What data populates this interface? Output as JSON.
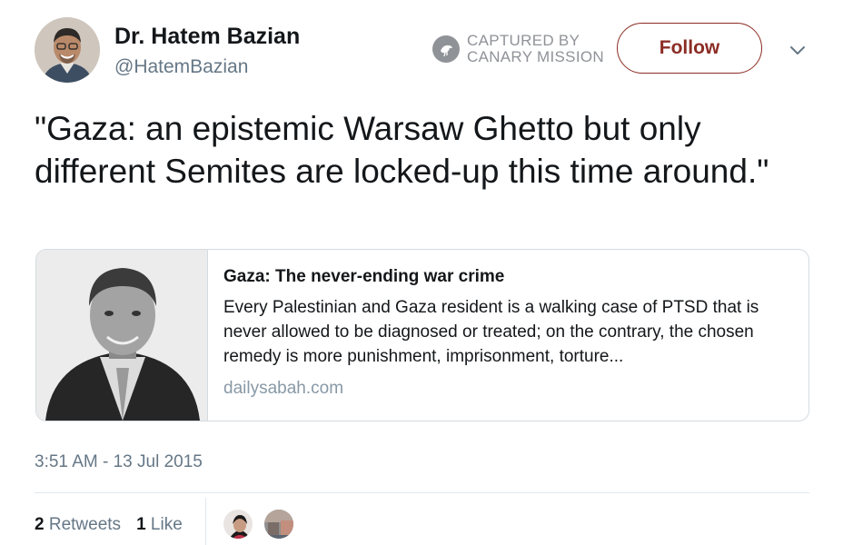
{
  "author": {
    "display_name": "Dr. Hatem Bazian",
    "handle": "@HatemBazian"
  },
  "watermark": {
    "line1": "CAPTURED BY",
    "line2": "CANARY MISSION",
    "icon": "canary-bird-icon"
  },
  "follow_button": {
    "label": "Follow",
    "color": "#8b2c24"
  },
  "tweet": {
    "text": "\"Gaza: an epistemic Warsaw Ghetto but only different Semites are locked-up this time around.\""
  },
  "card": {
    "title": "Gaza: The never-ending war crime",
    "description": "Every Palestinian and Gaza resident is a walking case of PTSD that is never allowed to be diagnosed or treated; on the contrary, the chosen remedy is more punishment, imprisonment, torture...",
    "domain": "dailysabah.com"
  },
  "timestamp": "3:51 AM - 13 Jul 2015",
  "stats": {
    "retweets_count": "2",
    "retweets_label": "Retweets",
    "likes_count": "1",
    "likes_label": "Like"
  },
  "colors": {
    "text": "#14171a",
    "secondary": "#657786",
    "link_gray": "#8899a6",
    "border": "#d5dbe0"
  }
}
